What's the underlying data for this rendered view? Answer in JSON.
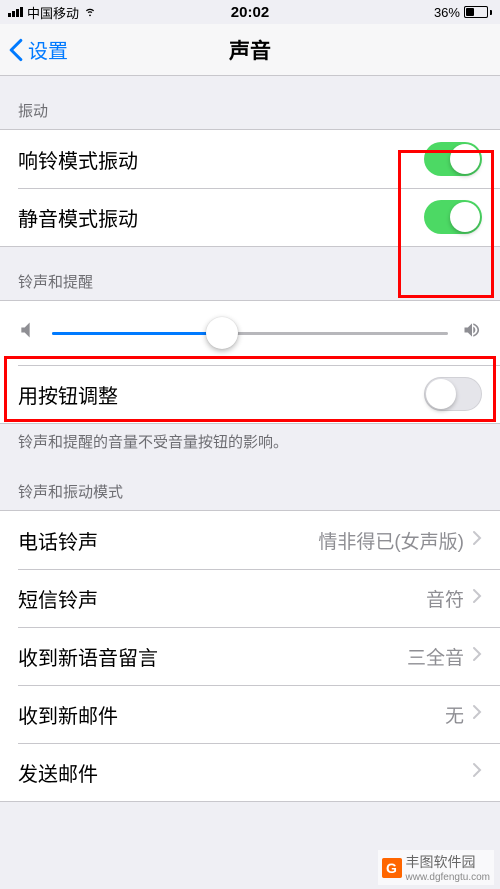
{
  "status": {
    "carrier": "中国移动",
    "time": "20:02",
    "battery_pct": "36%"
  },
  "nav": {
    "back": "设置",
    "title": "声音"
  },
  "sections": {
    "vibrate": {
      "header": "振动",
      "ring_vibrate": "响铃模式振动",
      "silent_vibrate": "静音模式振动"
    },
    "ringer": {
      "header": "铃声和提醒",
      "button_adjust": "用按钮调整",
      "footer": "铃声和提醒的音量不受音量按钮的影响。",
      "slider_pct": 43
    },
    "patterns": {
      "header": "铃声和振动模式",
      "ringtone": {
        "label": "电话铃声",
        "value": "情非得已(女声版)"
      },
      "texttone": {
        "label": "短信铃声",
        "value": "音符"
      },
      "voicemail": {
        "label": "收到新语音留言",
        "value": "三全音"
      },
      "mail": {
        "label": "收到新邮件",
        "value": "无"
      },
      "sentmail": {
        "label": "发送邮件",
        "value": ""
      }
    }
  },
  "watermark": {
    "brand": "丰图软件园",
    "url": "www.dgfengtu.com"
  }
}
